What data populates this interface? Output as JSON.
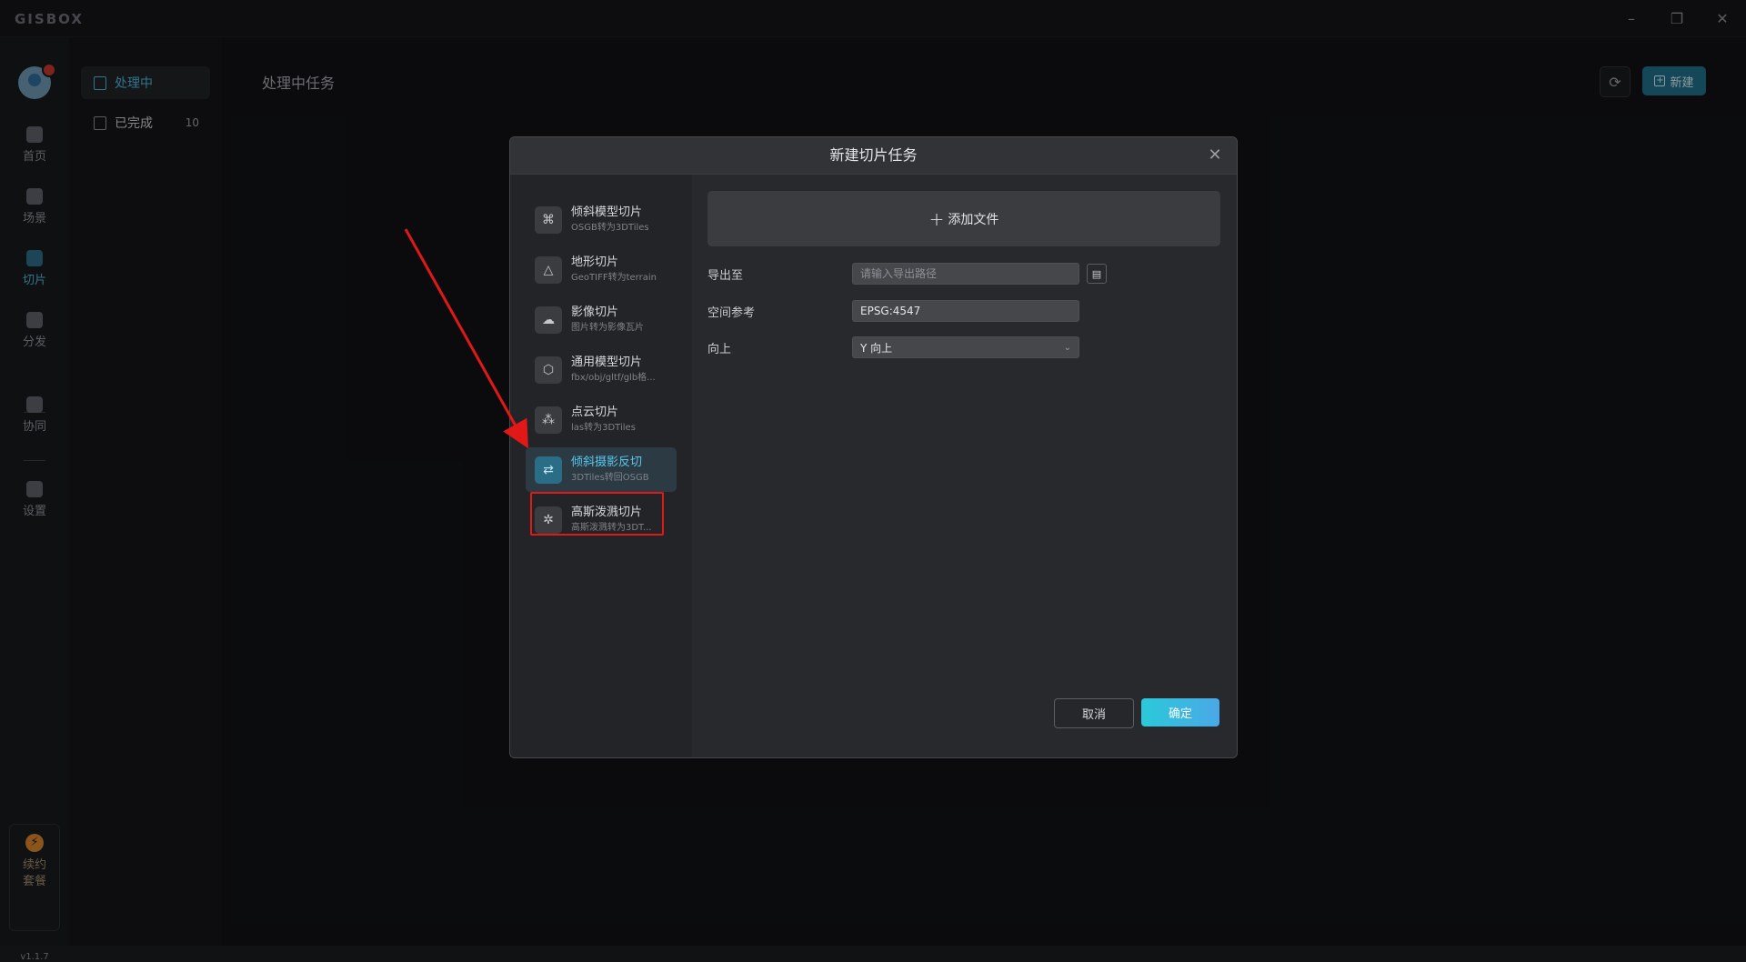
{
  "app": {
    "logo": "GISBOX",
    "minimize": "–",
    "restore": "❐",
    "close": "✕"
  },
  "rail": {
    "items": [
      {
        "label": "首页",
        "icon": "home-icon"
      },
      {
        "label": "场景",
        "icon": "cube-icon"
      },
      {
        "label": "切片",
        "icon": "tile-icon",
        "active": true
      },
      {
        "label": "分发",
        "icon": "share-icon"
      },
      {
        "label": "协同",
        "icon": "lock-icon"
      },
      {
        "label": "设置",
        "icon": "gear-icon"
      }
    ],
    "renew": {
      "line1": "续约",
      "line2": "套餐",
      "icon_glyph": "⚡"
    },
    "version": "v1.1.7"
  },
  "side": {
    "items": [
      {
        "label": "处理中",
        "active": true
      },
      {
        "label": "已完成",
        "count": "10"
      }
    ]
  },
  "main": {
    "title": "处理中任务",
    "refresh_glyph": "⟳",
    "new_label": "新建",
    "new_glyph": "+"
  },
  "modal": {
    "title": "新建切片任务",
    "close_glyph": "✕",
    "tasks": [
      {
        "title": "倾斜模型切片",
        "subtitle": "OSGB转为3DTiles",
        "glyph": "⌘"
      },
      {
        "title": "地形切片",
        "subtitle": "GeoTIFF转为terrain",
        "glyph": "△"
      },
      {
        "title": "影像切片",
        "subtitle": "图片转为影像瓦片",
        "glyph": "☁"
      },
      {
        "title": "通用模型切片",
        "subtitle": "fbx/obj/gltf/glb格...",
        "glyph": "⬡"
      },
      {
        "title": "点云切片",
        "subtitle": "las转为3DTiles",
        "glyph": "⁂"
      },
      {
        "title": "倾斜摄影反切",
        "subtitle": "3DTiles转回OSGB",
        "glyph": "⇄",
        "active": true
      },
      {
        "title": "高斯泼溅切片",
        "subtitle": "高斯泼溅转为3DT...",
        "glyph": "✲"
      }
    ],
    "add_file_plus": "+",
    "add_file_label": "添加文件",
    "fields": {
      "export_label": "导出至",
      "export_placeholder": "请输入导出路径",
      "export_value": "",
      "folder_glyph": "▤",
      "crs_label": "空间参考",
      "crs_value": "EPSG:4547",
      "up_label": "向上",
      "up_value": "Y 向上",
      "chevron_glyph": "⌄"
    },
    "cancel_label": "取消",
    "ok_label": "确定"
  }
}
